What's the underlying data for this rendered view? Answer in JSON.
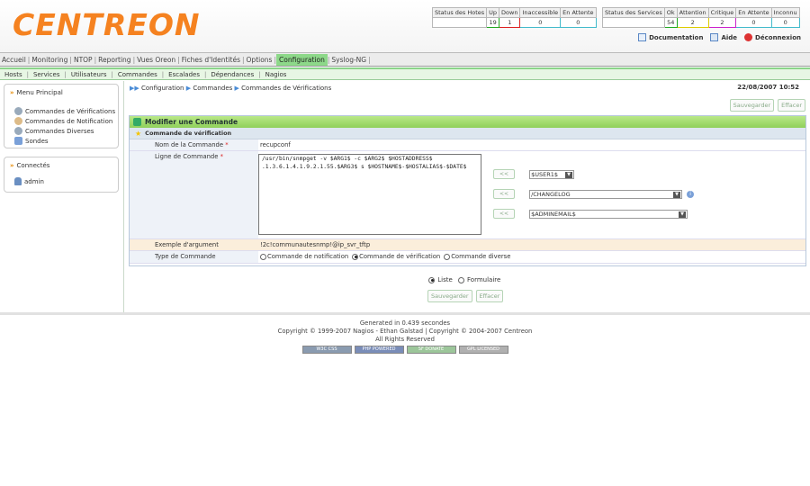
{
  "logo": {
    "text": "CENTREON"
  },
  "hosts_status": {
    "headers": [
      "Status des Hotes",
      "Up",
      "Down",
      "Inaccessible",
      "En Attente"
    ],
    "values": [
      "",
      "19",
      "1",
      "0",
      "0"
    ]
  },
  "services_status": {
    "headers": [
      "Status des Services",
      "Ok",
      "Attention",
      "Critique",
      "En Attente",
      "Inconnu"
    ],
    "values": [
      "",
      "54",
      "2",
      "2",
      "0",
      "0"
    ]
  },
  "toplinks": {
    "documentation": "Documentation",
    "help": "Aide",
    "logout": "Déconnexion"
  },
  "menu": [
    "Accueil",
    "Monitoring",
    "NTOP",
    "Reporting",
    "Vues Oreon",
    "Fiches d'Identités",
    "Options",
    "Configuration",
    "Syslog-NG"
  ],
  "submenu": [
    "Hosts",
    "Services",
    "Utilisateurs",
    "Commandes",
    "Escalades",
    "Dépendances",
    "Nagios"
  ],
  "sidebar": {
    "menu_title": "Menu Principal",
    "items": [
      "Commandes de Vérifications",
      "Commandes de Notification",
      "Commandes Diverses",
      "Sondes"
    ],
    "connected_title": "Connectés",
    "users": [
      "admin"
    ]
  },
  "breadcrumb": [
    "Configuration",
    "Commandes",
    "Commandes de Vérifications"
  ],
  "datetime": "22/08/2007 10:52",
  "buttons": {
    "save": "Sauvegarder",
    "clear": "Effacer",
    "add": "<<"
  },
  "form": {
    "title": "Modifier une Commande",
    "section": "Commande de vérification",
    "name_label": "Nom de la Commande",
    "name_value": "recupconf",
    "cmdline_label": "Ligne de Commande",
    "cmdline_value": "/usr/bin/snmpget -v $ARG1$ -c $ARG2$ $HOSTADDRESS$ .1.3.6.1.4.1.9.2.1.55.$ARG3$ s $HOSTNAME$-$HOSTALIAS$-$DATE$",
    "macro1": "$USER1$",
    "macro2": "/CHANGELOG",
    "macro3": "$ADMINEMAIL$",
    "example_label": "Exemple d'argument",
    "example_value": "!2c!communautesnmp!@ip_svr_tftp",
    "type_label": "Type de Commande",
    "type_options": [
      "Commande de notification",
      "Commande de vérification",
      "Commande diverse"
    ],
    "type_selected": "Commande de vérification"
  },
  "view": {
    "options": [
      "Liste",
      "Formulaire"
    ],
    "selected": "Liste"
  },
  "footer": {
    "generated": "Generated in 0.439 secondes",
    "copyright": "Copyright © 1999-2007 Nagios - Ethan Galstad | Copyright © 2004-2007 Centreon",
    "rights": "All Rights Reserved",
    "badges": [
      "W3C CSS",
      "PHP POWERED",
      "SF DONATE",
      "GPL LICENSED"
    ]
  }
}
